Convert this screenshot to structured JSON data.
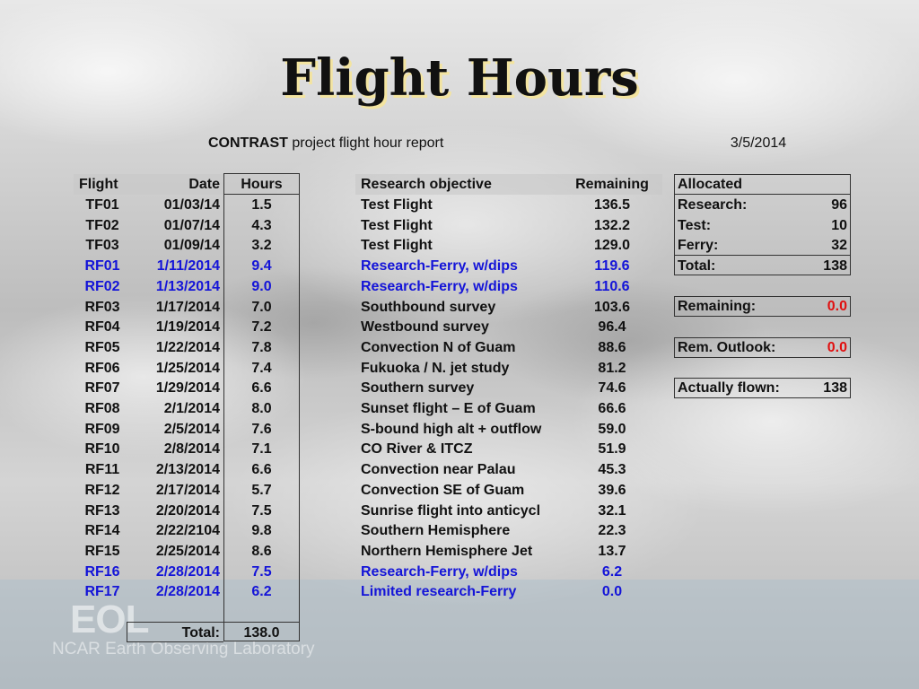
{
  "title": "Flight Hours",
  "subtitle": {
    "bold": "CONTRAST",
    "rest": " project flight hour report"
  },
  "report_date": "3/5/2014",
  "table": {
    "headers": {
      "flight": "Flight",
      "date": "Date",
      "hours": "Hours",
      "objective": "Research objective",
      "remaining": "Remaining"
    },
    "rows": [
      {
        "flight": "TF01",
        "date": "01/03/14",
        "hours": "1.5",
        "objective": "Test Flight",
        "remaining": "136.5",
        "color": "black"
      },
      {
        "flight": "TF02",
        "date": "01/07/14",
        "hours": "4.3",
        "objective": "Test Flight",
        "remaining": "132.2",
        "color": "black"
      },
      {
        "flight": "TF03",
        "date": "01/09/14",
        "hours": "3.2",
        "objective": "Test Flight",
        "remaining": "129.0",
        "color": "black"
      },
      {
        "flight": "RF01",
        "date": "1/11/2014",
        "hours": "9.4",
        "objective": "Research-Ferry, w/dips",
        "remaining": "119.6",
        "color": "blue"
      },
      {
        "flight": "RF02",
        "date": "1/13/2014",
        "hours": "9.0",
        "objective": "Research-Ferry, w/dips",
        "remaining": "110.6",
        "color": "blue"
      },
      {
        "flight": "RF03",
        "date": "1/17/2014",
        "hours": "7.0",
        "objective": "Southbound survey",
        "remaining": "103.6",
        "color": "black"
      },
      {
        "flight": "RF04",
        "date": "1/19/2014",
        "hours": "7.2",
        "objective": "Westbound survey",
        "remaining": "96.4",
        "color": "black"
      },
      {
        "flight": "RF05",
        "date": "1/22/2014",
        "hours": "7.8",
        "objective": "Convection N of Guam",
        "remaining": "88.6",
        "color": "black"
      },
      {
        "flight": "RF06",
        "date": "1/25/2014",
        "hours": "7.4",
        "objective": "Fukuoka / N. jet study",
        "remaining": "81.2",
        "color": "black"
      },
      {
        "flight": "RF07",
        "date": "1/29/2014",
        "hours": "6.6",
        "objective": "Southern survey",
        "remaining": "74.6",
        "color": "black"
      },
      {
        "flight": "RF08",
        "date": "2/1/2014",
        "hours": "8.0",
        "objective": "Sunset flight – E of Guam",
        "remaining": "66.6",
        "color": "black"
      },
      {
        "flight": "RF09",
        "date": "2/5/2014",
        "hours": "7.6",
        "objective": "S-bound high alt + outflow",
        "remaining": "59.0",
        "color": "black"
      },
      {
        "flight": "RF10",
        "date": "2/8/2014",
        "hours": "7.1",
        "objective": "CO River & ITCZ",
        "remaining": "51.9",
        "color": "black"
      },
      {
        "flight": "RF11",
        "date": "2/13/2014",
        "hours": "6.6",
        "objective": "Convection near Palau",
        "remaining": "45.3",
        "color": "black"
      },
      {
        "flight": "RF12",
        "date": "2/17/2014",
        "hours": "5.7",
        "objective": "Convection SE of Guam",
        "remaining": "39.6",
        "color": "black"
      },
      {
        "flight": "RF13",
        "date": "2/20/2014",
        "hours": "7.5",
        "objective": "Sunrise flight into anticycl",
        "remaining": "32.1",
        "color": "black"
      },
      {
        "flight": "RF14",
        "date": "2/22/2104",
        "hours": "9.8",
        "objective": "Southern Hemisphere",
        "remaining": "22.3",
        "color": "black"
      },
      {
        "flight": "RF15",
        "date": "2/25/2014",
        "hours": "8.6",
        "objective": "Northern Hemisphere Jet",
        "remaining": "13.7",
        "color": "black"
      },
      {
        "flight": "RF16",
        "date": "2/28/2014",
        "hours": "7.5",
        "objective": "Research-Ferry, w/dips",
        "remaining": "6.2",
        "color": "blue"
      },
      {
        "flight": "RF17",
        "date": "2/28/2014",
        "hours": "6.2",
        "objective": "Limited research-Ferry",
        "remaining": "0.0",
        "color": "blue"
      }
    ],
    "total_label": "Total:",
    "total_value": "138.0"
  },
  "allocated": {
    "header": "Allocated",
    "rows": [
      {
        "label": "Research:",
        "value": "96"
      },
      {
        "label": "Test:",
        "value": "10"
      },
      {
        "label": "Ferry:",
        "value": "32"
      }
    ],
    "total_label": "Total:",
    "total_value": "138"
  },
  "remaining": {
    "label": "Remaining:",
    "value": "0.0"
  },
  "outlook": {
    "label": "Rem. Outlook:",
    "value": "0.0"
  },
  "flown": {
    "label": "Actually flown:",
    "value": "138"
  },
  "footer": {
    "logo": "EOL",
    "text": "NCAR Earth Observing Laboratory"
  },
  "colors": {
    "blue": "#1414d8",
    "red": "#e01010",
    "title_shadow": "#f3e4a0"
  }
}
